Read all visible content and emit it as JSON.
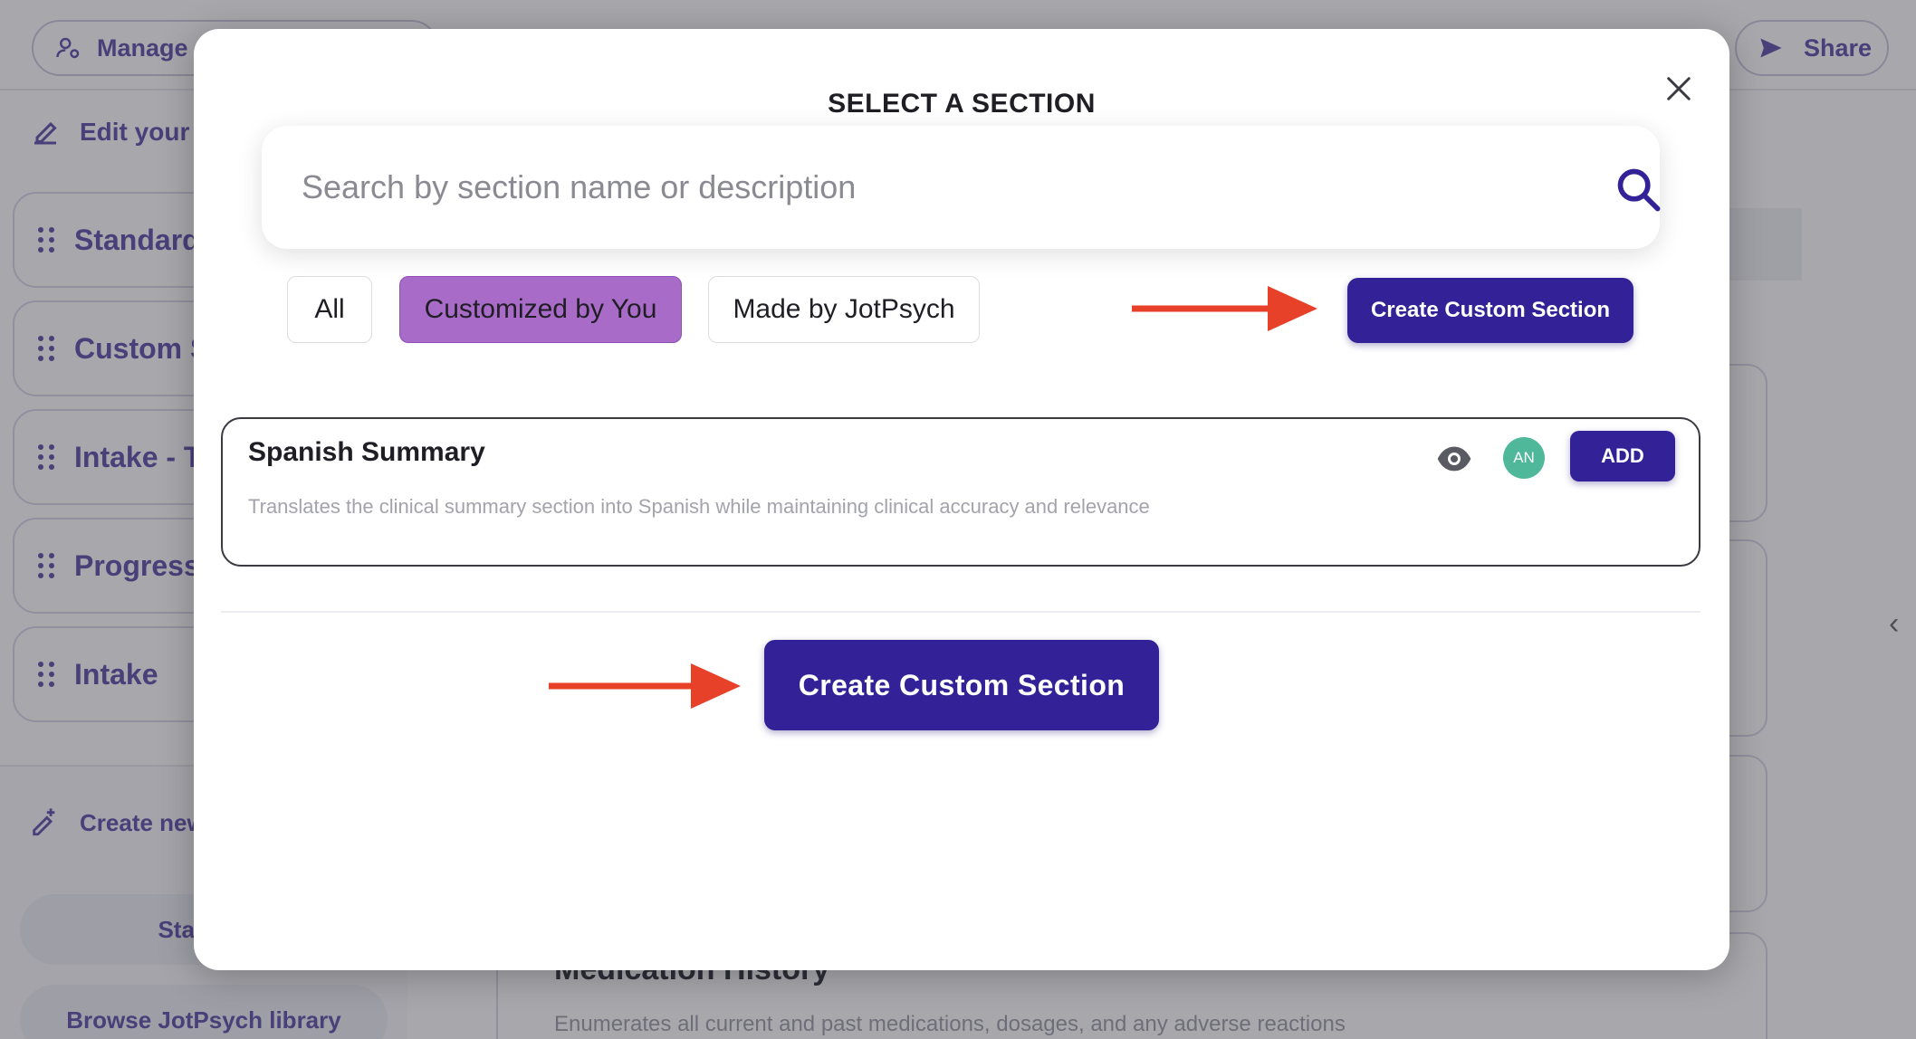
{
  "background": {
    "topbar": {
      "manage_label": "Manage",
      "share_label": "Share"
    },
    "sidebar": {
      "edit_label": "Edit your t",
      "items": [
        {
          "label": "Standard"
        },
        {
          "label": "Custom S"
        },
        {
          "label": "Intake - T"
        },
        {
          "label": "Progress"
        },
        {
          "label": "Intake"
        }
      ],
      "create_label": "Create new",
      "start_label": "Start fro",
      "browse_label": "Browse JotPsych library"
    },
    "main": {
      "card_title": "Medication History",
      "card_description": "Enumerates all current and past medications, dosages, and any adverse reactions"
    }
  },
  "modal": {
    "title": "SELECT A SECTION",
    "search": {
      "placeholder": "Search by section name or description",
      "value": ""
    },
    "filters": [
      {
        "label": "All",
        "active": false
      },
      {
        "label": "Customized by You",
        "active": true
      },
      {
        "label": "Made by JotPsych",
        "active": false
      }
    ],
    "create_button_top": "Create Custom Section",
    "sections": [
      {
        "title": "Spanish Summary",
        "description": "Translates the clinical summary section into Spanish while maintaining clinical accuracy and relevance",
        "author_initials": "AN",
        "add_label": "ADD"
      }
    ],
    "create_button_bottom": "Create Custom Section"
  },
  "colors": {
    "primary": "#322197",
    "active_filter": "#a86bc8",
    "arrow": "#e8412a",
    "avatar": "#4fb89a"
  },
  "icons": [
    "close-icon",
    "search-icon",
    "eye-icon",
    "arrow-right-icon",
    "grip-icon",
    "pencil-icon",
    "send-icon",
    "chevron-left-icon"
  ]
}
